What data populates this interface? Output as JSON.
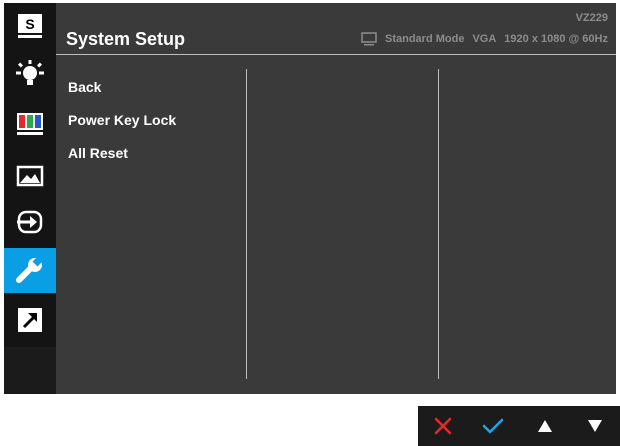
{
  "osd": {
    "title": "System Setup",
    "model": "VZ229",
    "status": {
      "mode": "Standard Mode",
      "input": "VGA",
      "resolution": "1920 x 1080 @ 60Hz",
      "icon": "monitor-icon"
    },
    "menu_items": [
      "Back",
      "Power Key Lock",
      "All Reset"
    ]
  },
  "sidebar": {
    "items": [
      {
        "icon": "splendid-s-icon",
        "label": "S"
      },
      {
        "icon": "brightness-sun-icon"
      },
      {
        "icon": "color-bars-icon"
      },
      {
        "icon": "image-icon"
      },
      {
        "icon": "input-select-icon"
      },
      {
        "icon": "system-setup-wrench-icon",
        "active": true
      },
      {
        "icon": "shortcut-arrow-icon"
      }
    ]
  },
  "controls": [
    "close-icon",
    "confirm-check-icon",
    "up-arrow-icon",
    "down-arrow-icon"
  ],
  "colors": {
    "accent": "#0a9fe4",
    "close": "#e8262b",
    "check": "#1aa3e8"
  }
}
